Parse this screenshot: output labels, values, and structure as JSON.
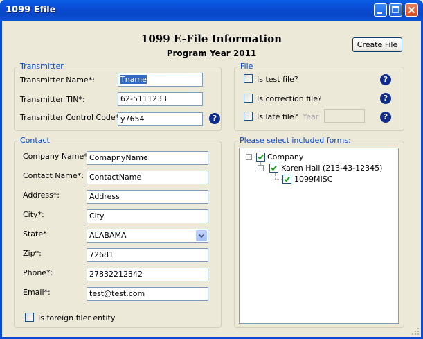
{
  "window": {
    "title": "1099 Efile"
  },
  "header": {
    "title": "1099 E-File Information",
    "subtitle": "Program Year 2011"
  },
  "toolbar": {
    "create_file_label": "Create File"
  },
  "transmitter": {
    "group_label": "Transmitter",
    "name_label": "Transmitter Name*:",
    "name_value": "Tname",
    "tin_label": "Transmitter TIN*:",
    "tin_value": "62-5111233",
    "control_code_label": "Transmitter Control Code*:",
    "control_code_value": "y7654"
  },
  "file": {
    "group_label": "File",
    "is_test_label": "Is test file?",
    "is_correction_label": "Is correction file?",
    "is_late_label": "Is late file?",
    "year_label": "Year",
    "year_value": ""
  },
  "contact": {
    "group_label": "Contact",
    "company_label": "Company Name*:",
    "company_value": "ComapnyName",
    "contact_label": "Contact Name*:",
    "contact_value": "ContactName",
    "address_label": "Address*:",
    "address_value": "Address",
    "city_label": "City*:",
    "city_value": "City",
    "state_label": "State*:",
    "state_value": "ALABAMA",
    "zip_label": "Zip*:",
    "zip_value": "72681",
    "phone_label": "Phone*:",
    "phone_value": "27832212342",
    "email_label": "Email*:",
    "email_value": "test@test.com",
    "foreign_label": "Is foreign filer entity"
  },
  "forms": {
    "group_label": "Please select included forms:",
    "tree": [
      {
        "label": "Company",
        "checked": true
      },
      {
        "label": "Karen Hall (213-43-12345)",
        "checked": true
      },
      {
        "label": "1099MISC",
        "checked": true
      }
    ]
  },
  "colors": {
    "titlebar": "#0A4BD4",
    "group_label": "#0046D5",
    "window_bg": "#ECE9D8",
    "help_icon": "#0F2C8C"
  }
}
